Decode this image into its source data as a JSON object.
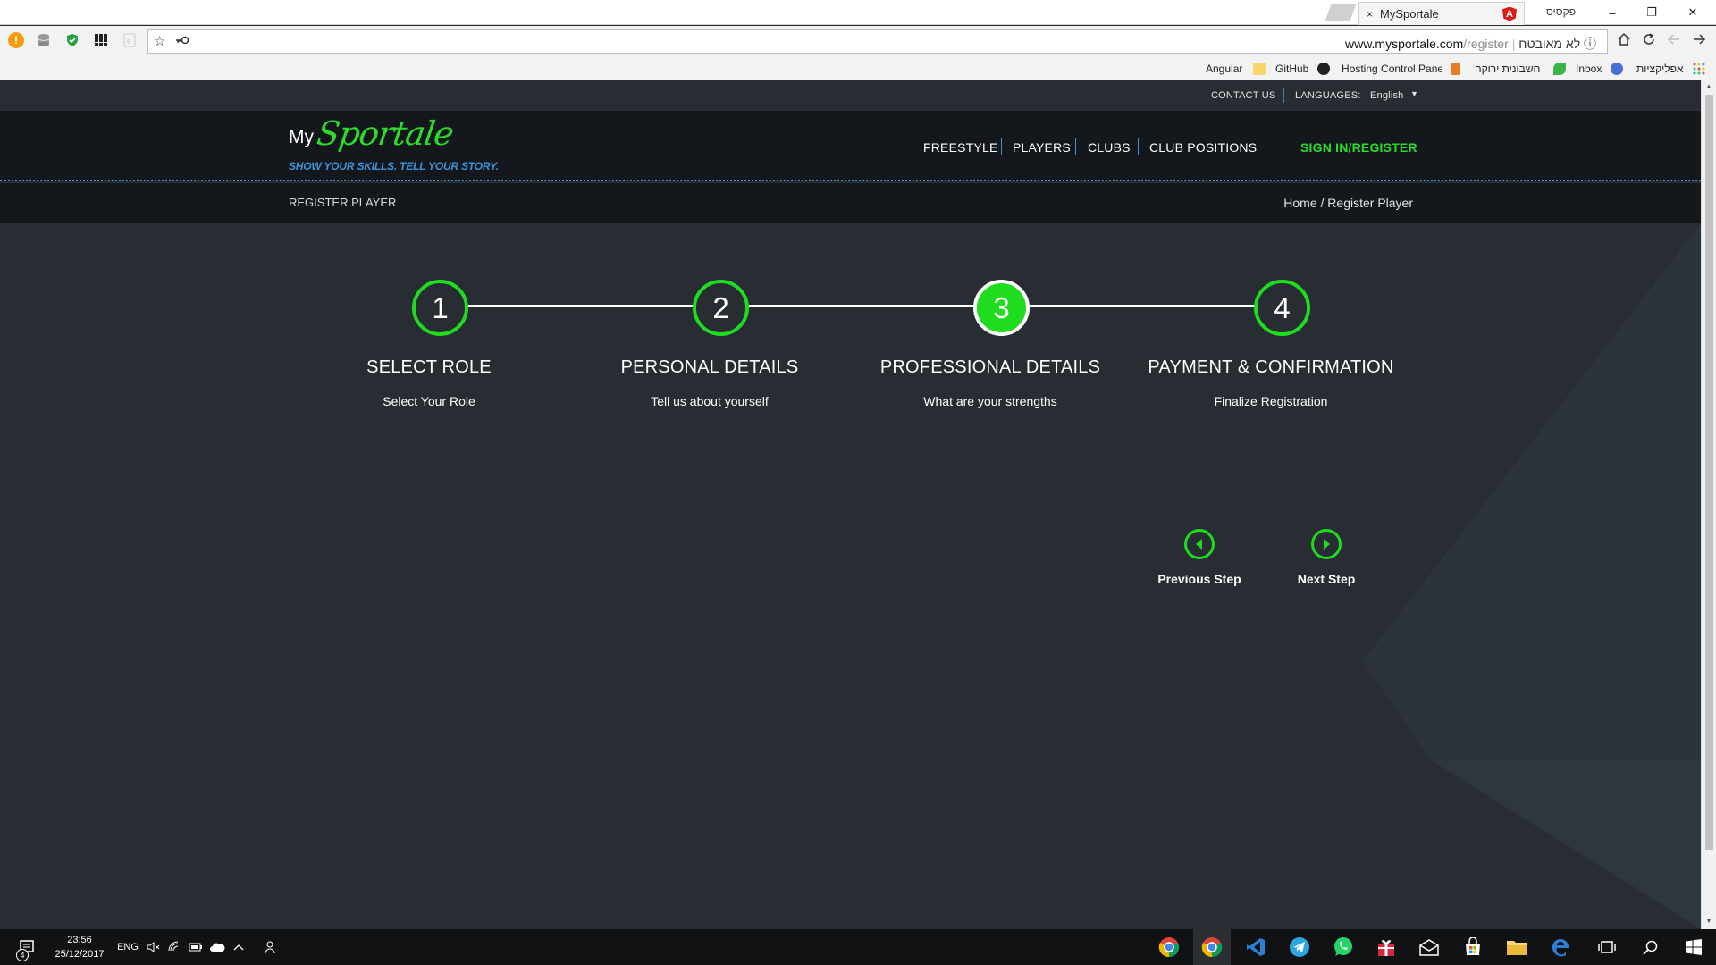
{
  "browser": {
    "tab_title": "MySportale",
    "tab_close": "×",
    "profile_label": "פקסיס",
    "url_security": "לא מאובטח",
    "url_host": "www.mysportale.com",
    "url_path": "/register",
    "minimize": "–",
    "restore": "❐",
    "close": "✕",
    "bookmarks": [
      "Angular",
      "GitHub",
      "Hosting Control Pane",
      "חשבונית ירוקה",
      "Inbox",
      "אפליקציות"
    ]
  },
  "site": {
    "topbar": {
      "contact": "CONTACT US",
      "languages_label": "LANGUAGES:",
      "language_value": "English",
      "dropdown_arrow": "▼"
    },
    "logo": {
      "my": "My",
      "sportale": "Sportale",
      "tagline": "SHOW YOUR SKILLS. TELL YOUR STORY."
    },
    "nav": {
      "freestyle": "FREESTYLE",
      "players": "PLAYERS",
      "clubs": "CLUBS",
      "club_positions": "CLUB POSITIONS",
      "signin": "SIGN IN/REGISTER"
    },
    "breadcrumb": {
      "title": "REGISTER PLAYER",
      "path": "Home / Register Player"
    },
    "steps": [
      {
        "number": "1",
        "title": "SELECT ROLE",
        "subtitle": "Select Your Role"
      },
      {
        "number": "2",
        "title": "PERSONAL DETAILS",
        "subtitle": "Tell us about yourself"
      },
      {
        "number": "3",
        "title": "PROFESSIONAL DETAILS",
        "subtitle": "What are your strengths"
      },
      {
        "number": "4",
        "title": "PAYMENT & CONFIRMATION",
        "subtitle": "Finalize Registration"
      }
    ],
    "active_step": 3,
    "step_nav": {
      "previous": "Previous Step",
      "next": "Next Step"
    },
    "colors": {
      "accent_green": "#1fdc1f",
      "accent_blue": "#3b94d9",
      "page_bg": "#272d33",
      "header_bg": "#14181c"
    }
  },
  "taskbar": {
    "notification_count": "4",
    "time": "23:56",
    "date": "25/12/2017",
    "language": "ENG"
  }
}
